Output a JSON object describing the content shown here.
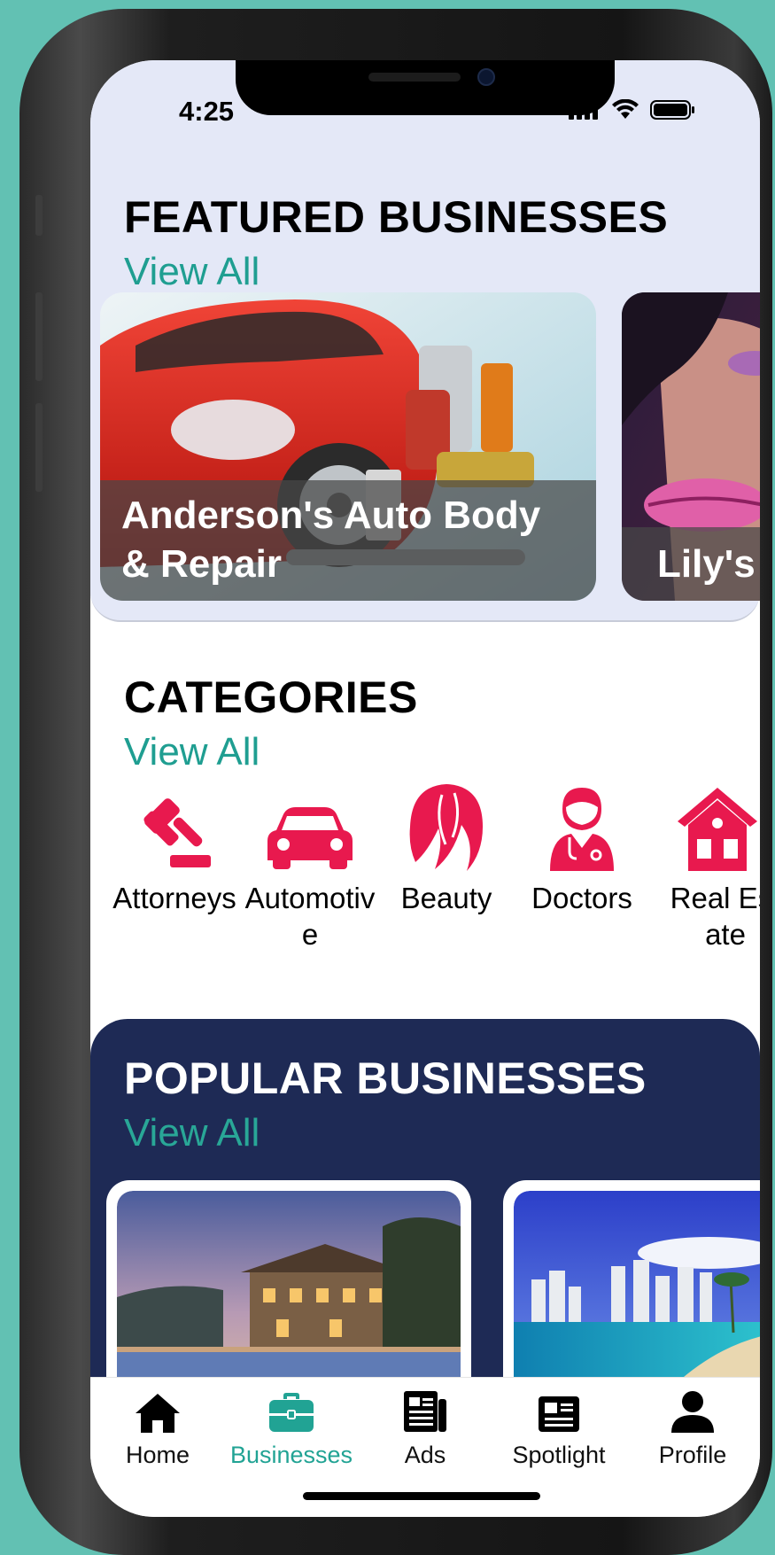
{
  "status_bar": {
    "time": "4:25"
  },
  "featured": {
    "title": "FEATURED BUSINESSES",
    "view_all": "View All",
    "cards": [
      {
        "label": "Anderson's Auto Body & Repair"
      },
      {
        "label": "Lily's"
      }
    ]
  },
  "categories": {
    "title": "CATEGORIES",
    "view_all": "View All",
    "items": [
      {
        "label": "Attorneys",
        "icon": "gavel-icon"
      },
      {
        "label": "Automotive",
        "icon": "car-icon"
      },
      {
        "label": "Beauty",
        "icon": "hair-icon"
      },
      {
        "label": "Doctors",
        "icon": "doctor-icon"
      },
      {
        "label": "Real Estate",
        "icon": "house-icon"
      }
    ]
  },
  "popular": {
    "title": "POPULAR BUSINESSES",
    "view_all": "View All"
  },
  "tabbar": {
    "tabs": [
      {
        "label": "Home",
        "icon": "home-icon"
      },
      {
        "label": "Businesses",
        "icon": "briefcase-icon",
        "active": true
      },
      {
        "label": "Ads",
        "icon": "newspaper-icon"
      },
      {
        "label": "Spotlight",
        "icon": "spotlight-icon"
      },
      {
        "label": "Profile",
        "icon": "person-icon"
      }
    ]
  },
  "colors": {
    "accent": "#1f9e91",
    "icon_red": "#e8194e",
    "navy": "#1e2a55",
    "featured_bg": "#e4e8f7"
  }
}
